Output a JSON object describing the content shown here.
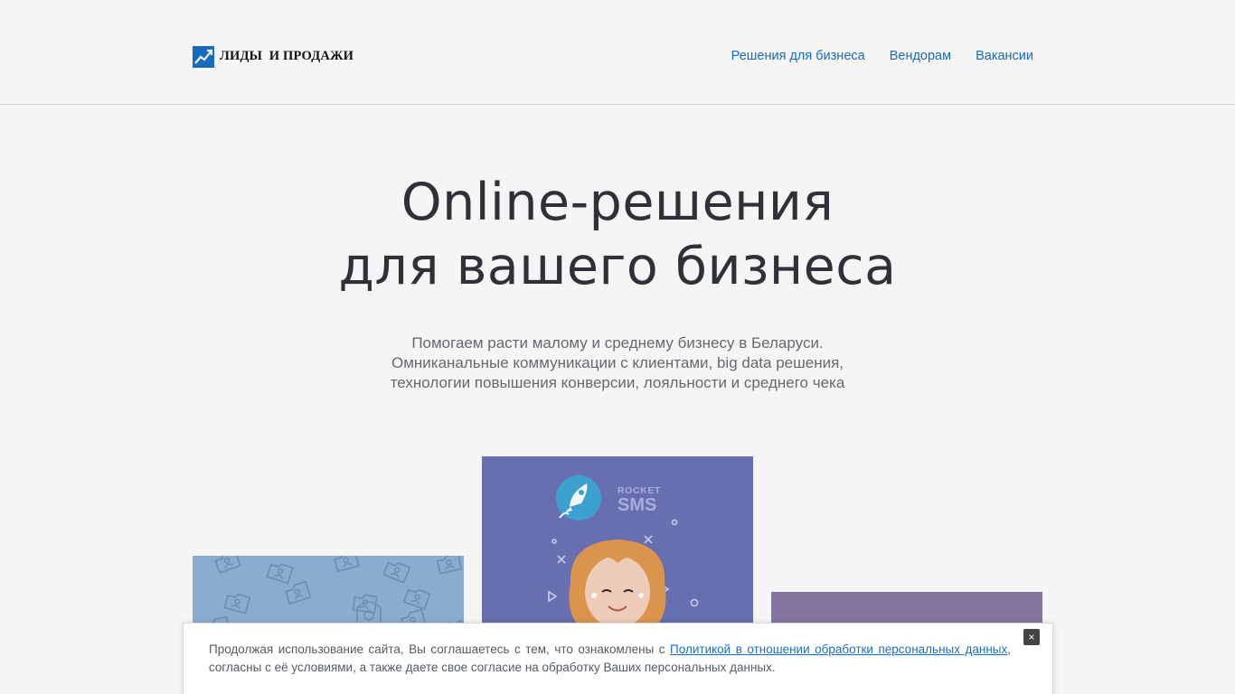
{
  "header": {
    "logo_text": "ЛИДЫ  И ПРОДАЖИ",
    "nav": [
      {
        "label": "Решения для бизнеса"
      },
      {
        "label": "Вендорам"
      },
      {
        "label": "Вакансии"
      }
    ]
  },
  "hero": {
    "title_line1": "Online-решения",
    "title_line2": "для вашего бизнеса",
    "subtitle_lines": [
      "Помогаем расти малому и среднему бизнесу в Беларуси.",
      "Омниканальные коммуникации с клиентами, big data решения,",
      "технологии повышения конверсии, лояльности и среднего чека"
    ]
  },
  "cards": {
    "sms_brand_top": "ROCKET",
    "sms_brand_bottom": "SMS"
  },
  "cookie": {
    "text_before": "Продолжая использование сайта, Вы соглашаетесь с тем, что ознакомлены с ",
    "link_text": "Политикой в отношении обработки персональных данных",
    "text_after": ", согласны с её условиями, а также даете свое согласие на обработку Ваших персональных данных.",
    "close_label": "×"
  },
  "colors": {
    "link": "#1a6fc4",
    "title": "#30343a",
    "logo_blue": "#1a6fc4"
  }
}
